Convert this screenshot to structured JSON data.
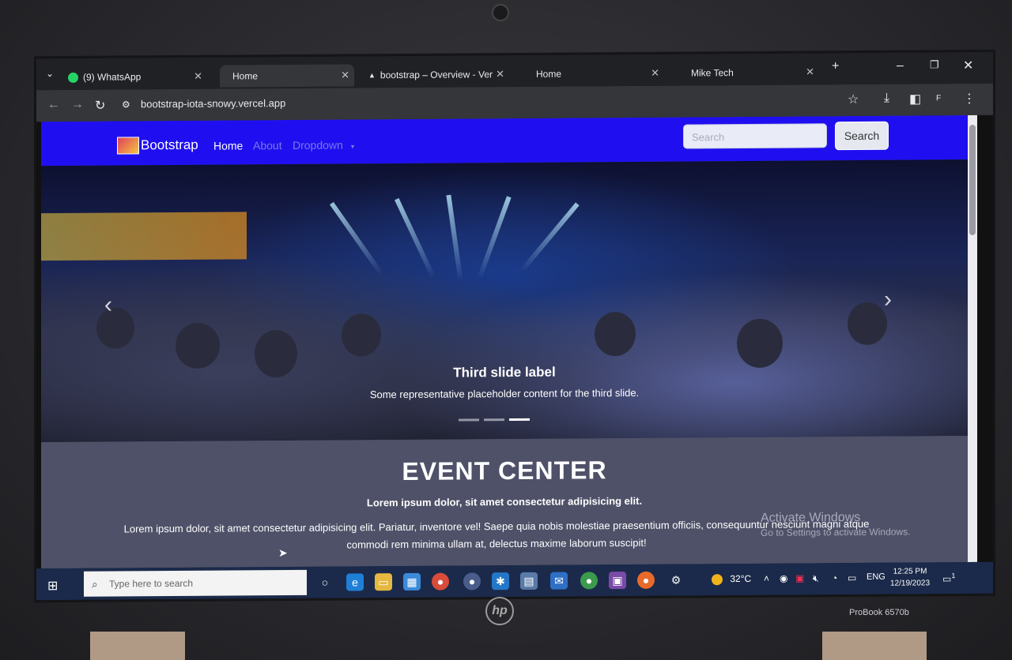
{
  "browser": {
    "tabs": [
      {
        "label": "(9) WhatsApp",
        "icon": "whatsapp-icon"
      },
      {
        "label": "Home"
      },
      {
        "label": "bootstrap – Overview - Ver",
        "icon": "vercel-icon"
      },
      {
        "label": "Home"
      },
      {
        "label": "Mike Tech"
      }
    ],
    "url": "bootstrap-iota-snowy.vercel.app",
    "profile_initial": "F"
  },
  "page": {
    "brand": "Bootstrap",
    "nav": [
      {
        "label": "Home",
        "active": true
      },
      {
        "label": "About",
        "active": false
      },
      {
        "label": "Dropdown",
        "active": false
      }
    ],
    "search": {
      "placeholder": "Search",
      "button": "Search"
    },
    "carousel": {
      "caption_title": "Third slide label",
      "caption_text": "Some representative placeholder content for the third slide.",
      "active_slide": 3,
      "slide_count": 3
    },
    "section": {
      "title": "EVENT CENTER",
      "lead": "Lorem ipsum dolor, sit amet consectetur adipisicing elit.",
      "body": "Lorem ipsum dolor, sit amet consectetur adipisicing elit. Pariatur, inventore vel! Saepe quia nobis molestiae praesentium officiis, consequuntur nesciunt magni atque commodi rem minima ullam at, delectus maxime laborum suscipit!"
    },
    "watermark": {
      "line1": "Activate Windows",
      "line2": "Go to Settings to activate Windows."
    }
  },
  "taskbar": {
    "search_placeholder": "Type here to search",
    "weather": "32°C",
    "language": "ENG",
    "time": "12:25 PM",
    "date": "12/19/2023",
    "notification_count": "1"
  },
  "laptop": {
    "model": "ProBook 6570b",
    "brand": "hp"
  },
  "colors": {
    "navbar": "#1f0ff0",
    "taskbar": "#1b2a4a"
  }
}
